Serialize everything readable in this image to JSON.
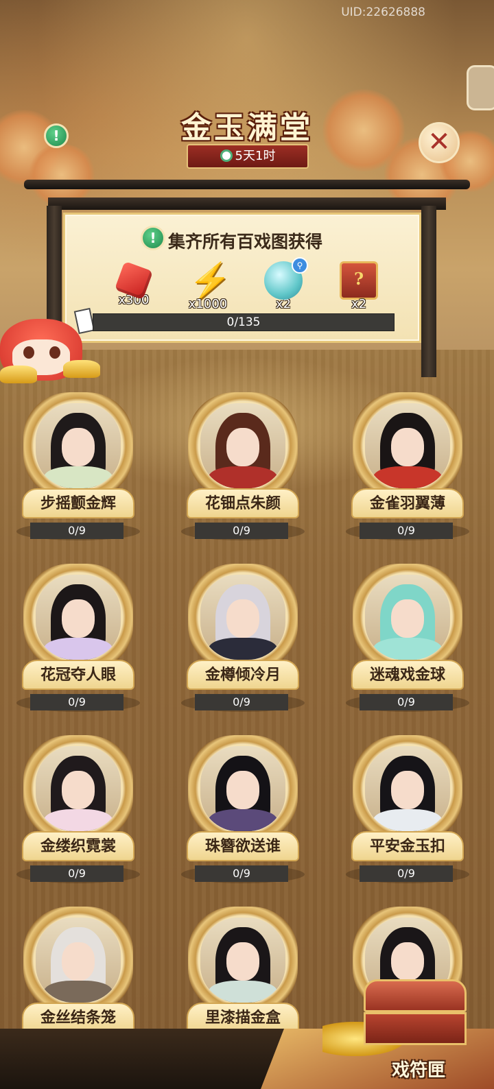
{
  "header": {
    "uid": "UID:22626888",
    "title": "金玉满堂",
    "timer": "5天1时"
  },
  "reward_panel": {
    "title": "集齐所有百戏图获得",
    "rewards": [
      {
        "icon": "red-gem-icon",
        "count": "x300"
      },
      {
        "icon": "lightning-bolt-icon",
        "count": "x1000"
      },
      {
        "icon": "jade-orb-icon",
        "count": "x2"
      },
      {
        "icon": "mystery-chest-icon",
        "count": "x2"
      }
    ],
    "progress": {
      "text": "0/135",
      "value": 0,
      "max": 135
    }
  },
  "cards": [
    {
      "name": "步摇颤金辉",
      "progress": "0/9",
      "hair": "#1f1a1a",
      "robe": "#d8e6c4"
    },
    {
      "name": "花钿点朱颜",
      "progress": "0/9",
      "hair": "#5a2a1c",
      "robe": "#b0302a"
    },
    {
      "name": "金雀羽翼薄",
      "progress": "0/9",
      "hair": "#1a1515",
      "robe": "#c8362a"
    },
    {
      "name": "花冠夺人眼",
      "progress": "0/9",
      "hair": "#1c1718",
      "robe": "#d9c6ec"
    },
    {
      "name": "金樽倾冷月",
      "progress": "0/9",
      "hair": "#d8d4dc",
      "robe": "#2b2c3a"
    },
    {
      "name": "迷魂戏金球",
      "progress": "0/9",
      "hair": "#7fd6c8",
      "robe": "#9fe3d6"
    },
    {
      "name": "金缕织霓裳",
      "progress": "0/9",
      "hair": "#201a1c",
      "robe": "#f3d8e4"
    },
    {
      "name": "珠簪欲送谁",
      "progress": "0/9",
      "hair": "#141216",
      "robe": "#5b4a7a"
    },
    {
      "name": "平安金玉扣",
      "progress": "0/9",
      "hair": "#161418",
      "robe": "#e8ecf0"
    },
    {
      "name": "金丝结条笼",
      "progress": "",
      "hair": "#e4e0dc",
      "robe": "#7a6a5a"
    },
    {
      "name": "里漆描金盒",
      "progress": "",
      "hair": "#1a1618",
      "robe": "#cfe0d8"
    },
    {
      "name": "",
      "progress": "",
      "hair": "#1a1618",
      "robe": "#3d3a40"
    }
  ],
  "bottom": {
    "chest_label": "戏符匣"
  },
  "colors": {
    "accent_gold": "#e7c779",
    "timer_red": "#9c2e24",
    "progress_track": "#3a3835"
  }
}
